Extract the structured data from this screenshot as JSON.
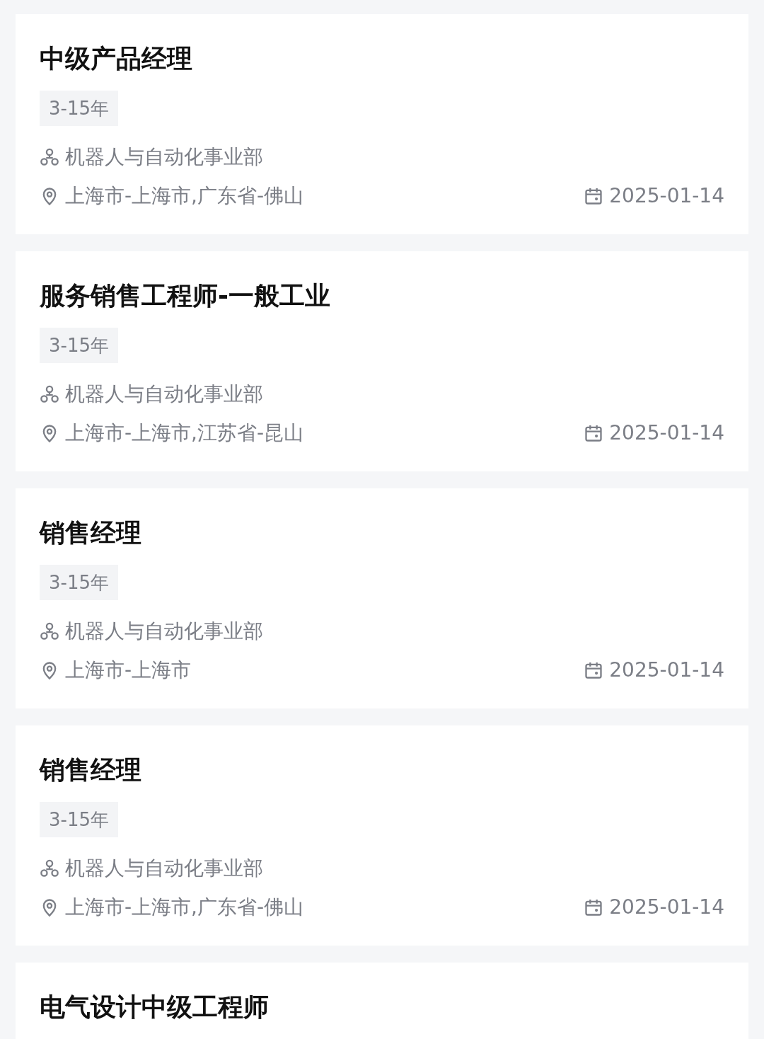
{
  "jobs": [
    {
      "title": "中级产品经理",
      "experience": "3-15年",
      "department": "机器人与自动化事业部",
      "location": "上海市-上海市,广东省-佛山",
      "date": "2025-01-14"
    },
    {
      "title": "服务销售工程师-一般工业",
      "experience": "3-15年",
      "department": "机器人与自动化事业部",
      "location": "上海市-上海市,江苏省-昆山",
      "date": "2025-01-14"
    },
    {
      "title": "销售经理",
      "experience": "3-15年",
      "department": "机器人与自动化事业部",
      "location": "上海市-上海市",
      "date": "2025-01-14"
    },
    {
      "title": "销售经理",
      "experience": "3-15年",
      "department": "机器人与自动化事业部",
      "location": "上海市-上海市,广东省-佛山",
      "date": "2025-01-14"
    },
    {
      "title": "电气设计中级工程师"
    }
  ]
}
